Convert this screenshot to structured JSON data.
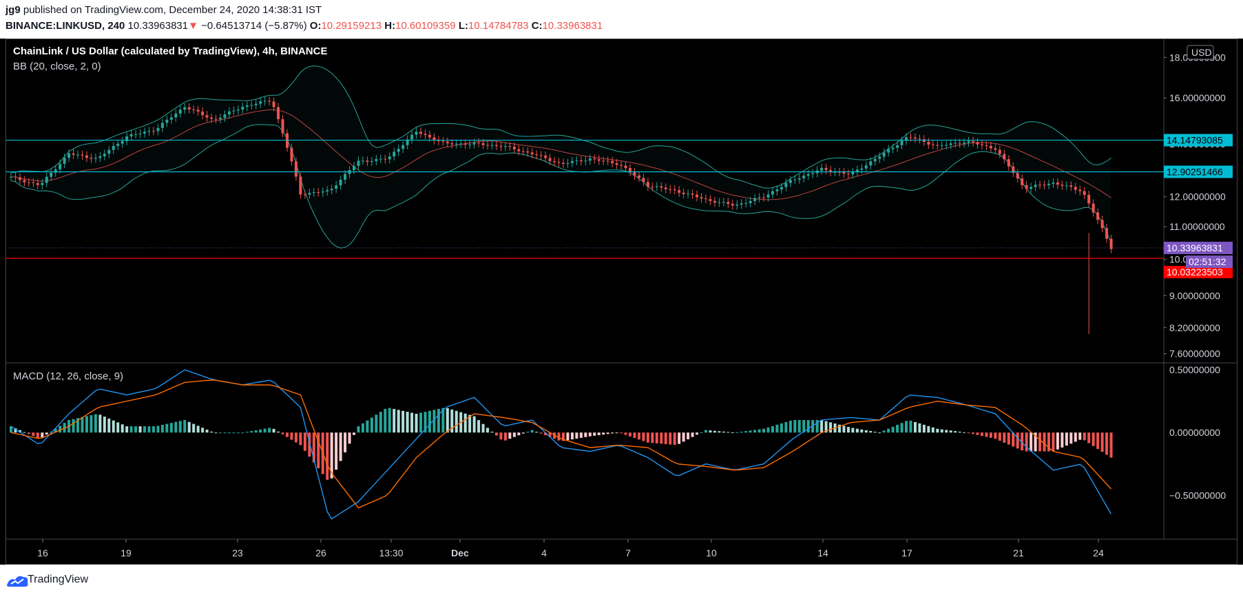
{
  "header": {
    "user": "jg9",
    "published": "published on TradingView.com, December 24, 2020 14:38:31 IST",
    "symbol": "BINANCE:LINKUSD, 240",
    "last": "10.33963831",
    "arrow": "▼",
    "change": "−0.64513714 (−5.87%)",
    "o_label": "O:",
    "o_value": "10.29159213",
    "h_label": "H:",
    "h_value": "10.60109359",
    "l_label": "L:",
    "l_value": "10.14784783",
    "c_label": "C:",
    "c_value": "10.33963831"
  },
  "legend": {
    "title": "ChainLink / US Dollar (calculated by TradingView), 4h, BINANCE",
    "bb": "BB (20, close, 2, 0)",
    "macd": "MACD (12, 26, close, 9)"
  },
  "currency": "USD",
  "footer": {
    "brand": "TradingView"
  },
  "colors": {
    "up": "#26a69a",
    "down": "#ef5350",
    "bb": "#26a69a",
    "basis": "#ef5350",
    "hline": "#00bcd4",
    "support": "#ff0000",
    "macd": "#2196f3",
    "signal": "#ff6d00",
    "current": "#7e57c2"
  },
  "chart_data": [
    {
      "type": "candlestick",
      "title": "ChainLink / US Dollar (calculated by TradingView), 4h, BINANCE",
      "x_ticks": [
        "16",
        "19",
        "23",
        "26",
        "13:30",
        "Dec",
        "4",
        "7",
        "10",
        "14",
        "17",
        "21",
        "24"
      ],
      "y_ticks": [
        "18.00000000",
        "16.00000000",
        "14.00000000",
        "12.00000000",
        "11.00000000",
        "10.00000000",
        "9.00000000",
        "8.20000000",
        "7.60000000"
      ],
      "y_scale": "log",
      "ylim": [
        7.4,
        18.6
      ],
      "horizontal_levels": [
        {
          "value": 14.14793085,
          "label": "14.14793085",
          "color": "cyan"
        },
        {
          "value": 12.90251466,
          "label": "12.90251466",
          "color": "cyan"
        },
        {
          "value": 10.03223503,
          "label": "10.03223503",
          "color": "red"
        }
      ],
      "current_price": {
        "value": 10.33963831,
        "label": "10.33963831",
        "countdown": "02:51:32"
      },
      "price_path": [
        {
          "x": "16",
          "close": 12.7
        },
        {
          "x": "17",
          "close": 12.4
        },
        {
          "x": "18",
          "close": 13.6
        },
        {
          "x": "19",
          "close": 13.4
        },
        {
          "x": "20",
          "close": 14.3
        },
        {
          "x": "21",
          "close": 14.6
        },
        {
          "x": "22",
          "close": 15.6
        },
        {
          "x": "23",
          "close": 15.0
        },
        {
          "x": "24",
          "close": 15.6
        },
        {
          "x": "25",
          "close": 15.9
        },
        {
          "x": "26",
          "close": 12.1
        },
        {
          "x": "27",
          "close": 12.2
        },
        {
          "x": "28",
          "close": 13.3
        },
        {
          "x": "29",
          "close": 13.4
        },
        {
          "x": "30",
          "close": 14.5
        },
        {
          "x": "Dec 1",
          "close": 14.0
        },
        {
          "x": "2",
          "close": 14.0
        },
        {
          "x": "3",
          "close": 13.9
        },
        {
          "x": "4",
          "close": 13.6
        },
        {
          "x": "5",
          "close": 13.2
        },
        {
          "x": "6",
          "close": 13.4
        },
        {
          "x": "7",
          "close": 13.2
        },
        {
          "x": "8",
          "close": 12.4
        },
        {
          "x": "9",
          "close": 12.2
        },
        {
          "x": "10",
          "close": 11.9
        },
        {
          "x": "11",
          "close": 11.7
        },
        {
          "x": "12",
          "close": 12.0
        },
        {
          "x": "13",
          "close": 12.6
        },
        {
          "x": "14",
          "close": 13.0
        },
        {
          "x": "15",
          "close": 12.8
        },
        {
          "x": "16",
          "close": 13.5
        },
        {
          "x": "17",
          "close": 14.3
        },
        {
          "x": "18",
          "close": 13.9
        },
        {
          "x": "19",
          "close": 14.1
        },
        {
          "x": "20",
          "close": 13.8
        },
        {
          "x": "21",
          "close": 12.3
        },
        {
          "x": "22",
          "close": 12.5
        },
        {
          "x": "23",
          "close": 12.2
        },
        {
          "x": "24",
          "close": 10.34
        }
      ],
      "spike_low": 8.05,
      "indicators": [
        "Bollinger Bands (20, close, 2, 0)"
      ]
    },
    {
      "type": "macd",
      "title": "MACD (12, 26, close, 9)",
      "y_ticks": [
        "0.50000000",
        "0.00000000",
        "−0.50000000"
      ],
      "ylim": [
        -0.85,
        0.55
      ],
      "macd_path": [
        0.05,
        -0.1,
        0.15,
        0.35,
        0.3,
        0.35,
        0.5,
        0.42,
        0.38,
        0.42,
        0.2,
        -0.7,
        -0.55,
        -0.3,
        -0.05,
        0.2,
        0.28,
        0.05,
        0.1,
        -0.12,
        -0.15,
        -0.1,
        -0.2,
        -0.35,
        -0.25,
        -0.3,
        -0.25,
        -0.05,
        0.1,
        0.12,
        0.1,
        0.3,
        0.28,
        0.22,
        0.15,
        -0.1,
        -0.3,
        -0.25,
        -0.65
      ],
      "signal_path": [
        0.0,
        -0.05,
        0.05,
        0.2,
        0.25,
        0.3,
        0.4,
        0.42,
        0.38,
        0.38,
        0.3,
        -0.3,
        -0.6,
        -0.5,
        -0.2,
        0.0,
        0.15,
        0.12,
        0.08,
        -0.05,
        -0.12,
        -0.1,
        -0.12,
        -0.25,
        -0.27,
        -0.3,
        -0.28,
        -0.15,
        0.0,
        0.08,
        0.1,
        0.2,
        0.25,
        0.22,
        0.2,
        0.05,
        -0.15,
        -0.2,
        -0.45
      ]
    }
  ]
}
